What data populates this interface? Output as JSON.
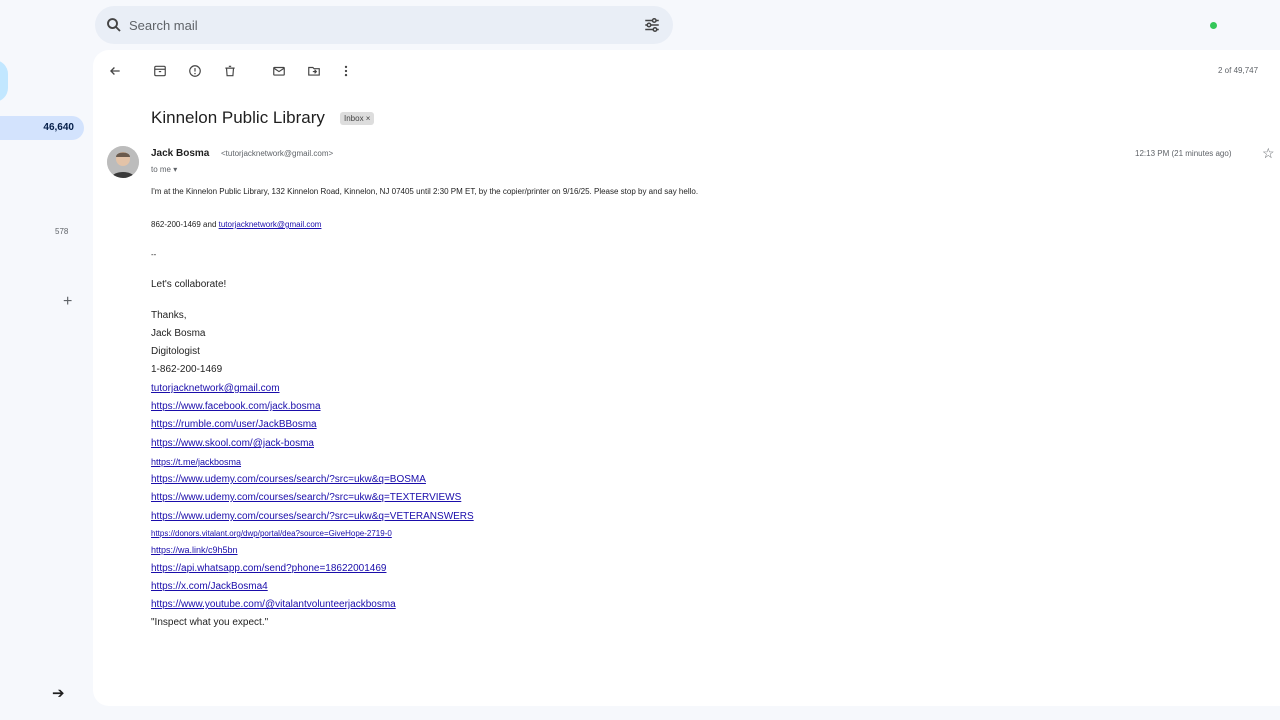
{
  "search": {
    "placeholder": "Search mail"
  },
  "sidebar": {
    "inbox_count": "46,640",
    "other_count": "578"
  },
  "toolbar": {
    "pager": "2 of 49,747"
  },
  "email": {
    "subject": "Kinnelon Public Library",
    "label": "Inbox ×",
    "sender_name": "Jack Bosma",
    "sender_email": "<tutorjacknetwork@gmail.com>",
    "to": "to me ▾",
    "time": "12:13 PM (21 minutes ago)",
    "body_line1": "I'm at the Kinnelon Public Library, 132 Kinnelon Road, Kinnelon, NJ 07405 until 2:30 PM ET, by the copier/printer on 9/16/25. Please stop by and say hello.",
    "phone_line_prefix": "862-200-1469 and ",
    "phone_line_link": "tutorjacknetwork@gmail.com",
    "dashes": "--",
    "collab": "Let's collaborate!",
    "thanks": "Thanks,",
    "name": "Jack Bosma",
    "title": "Digitologist",
    "phone": "1-862-200-1469",
    "links": [
      "tutorjacknetwork@gmail.com",
      "https://www.facebook.com/jack.bosma",
      "https://rumble.com/user/JackBBosma",
      "https://www.skool.com/@jack-bosma",
      "https://t.me/jackbosma",
      "https://www.udemy.com/courses/search/?src=ukw&q=BOSMA",
      "https://www.udemy.com/courses/search/?src=ukw&q=TEXTERVIEWS",
      "https://www.udemy.com/courses/search/?src=ukw&q=VETERANSWERS",
      "https://donors.vitalant.org/dwp/portal/dea?source=GiveHope-2719-0",
      "https://wa.link/c9h5bn",
      "https://api.whatsapp.com/send?phone=18622001469",
      "https://x.com/JackBosma4",
      "https://www.youtube.com/@vitalantvolunteerjackbosma"
    ],
    "quote": "\"Inspect what you expect.\""
  }
}
